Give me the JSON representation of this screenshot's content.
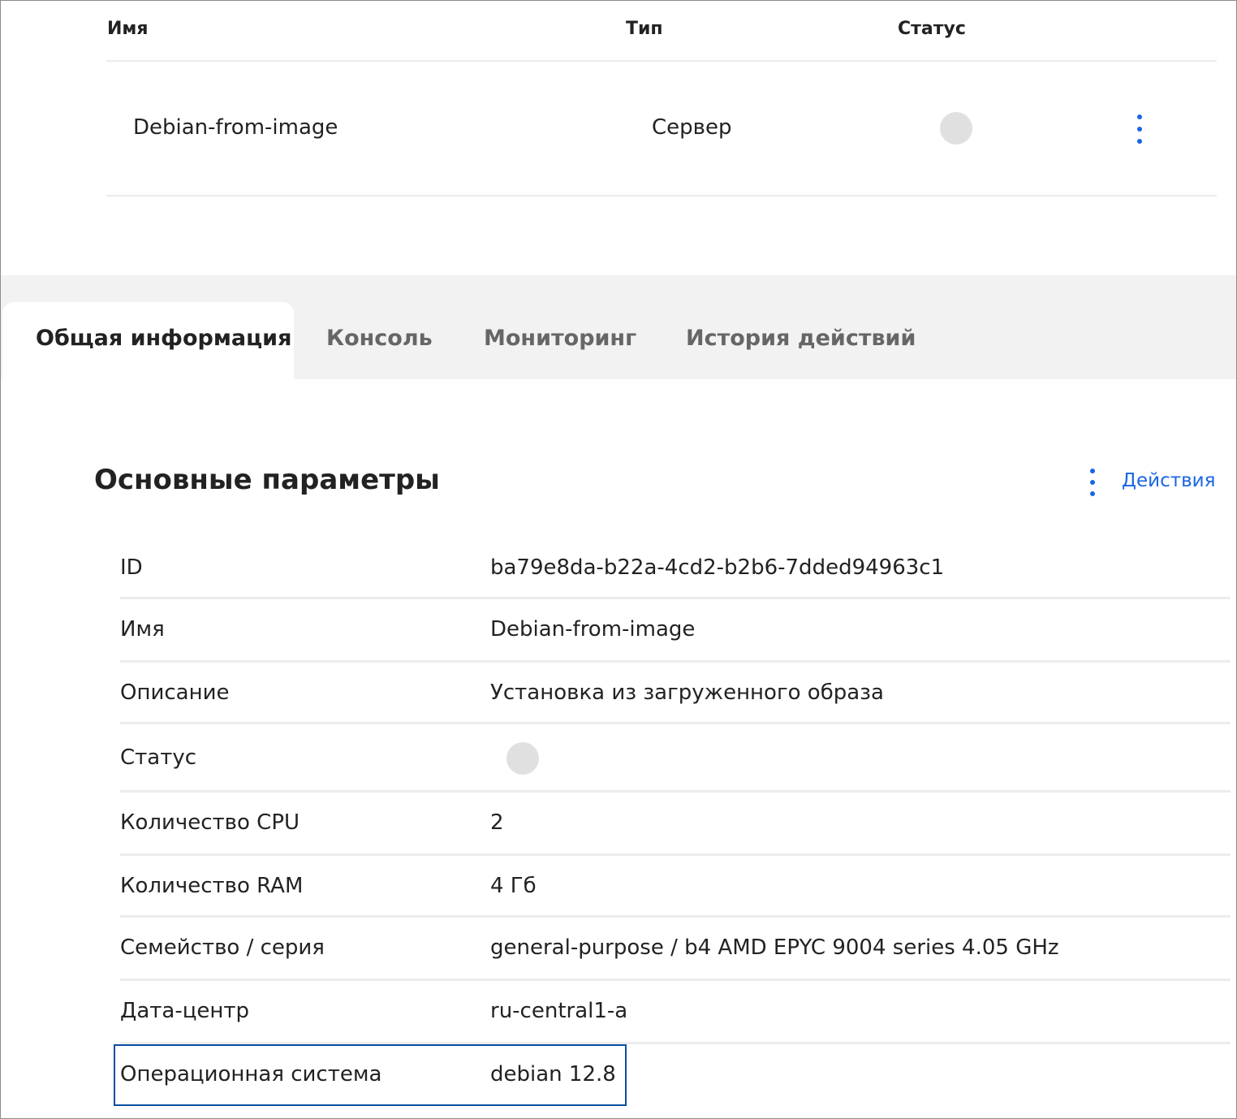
{
  "list": {
    "columns": {
      "name": "Имя",
      "type": "Тип",
      "status": "Статус"
    },
    "rows": [
      {
        "name": "Debian-from-image",
        "type": "Сервер",
        "status_color": "#e0e0e0",
        "menu_icon": "kebab-vertical-icon"
      }
    ]
  },
  "tabs": [
    {
      "label": "Общая информация",
      "active": true
    },
    {
      "label": "Консоль",
      "active": false
    },
    {
      "label": "Мониторинг",
      "active": false
    },
    {
      "label": "История действий",
      "active": false
    }
  ],
  "section": {
    "title": "Основные параметры",
    "actions_label": "Действия",
    "actions_icon": "kebab-vertical-icon"
  },
  "params": [
    {
      "label": "ID",
      "value": "ba79e8da-b22a-4cd2-b2b6-7dded94963c1"
    },
    {
      "label": "Имя",
      "value": "Debian-from-image"
    },
    {
      "label": "Описание",
      "value": "Установка из загруженного образа"
    },
    {
      "label": "Статус",
      "value": "",
      "status_color": "#e0e0e0"
    },
    {
      "label": "Количество CPU",
      "value": "2"
    },
    {
      "label": "Количество RAM",
      "value": "4 Гб"
    },
    {
      "label": "Семейство / серия",
      "value": "general-purpose / b4 AMD EPYC 9004 series 4.05 GHz"
    },
    {
      "label": "Дата-центр",
      "value": "ru-central1-a"
    },
    {
      "label": "Операционная система",
      "value": "debian 12.8",
      "highlighted": true
    }
  ],
  "colors": {
    "accent": "#1a66e6",
    "highlight_border": "#0b4ea2",
    "tab_band": "#f2f2f2"
  }
}
